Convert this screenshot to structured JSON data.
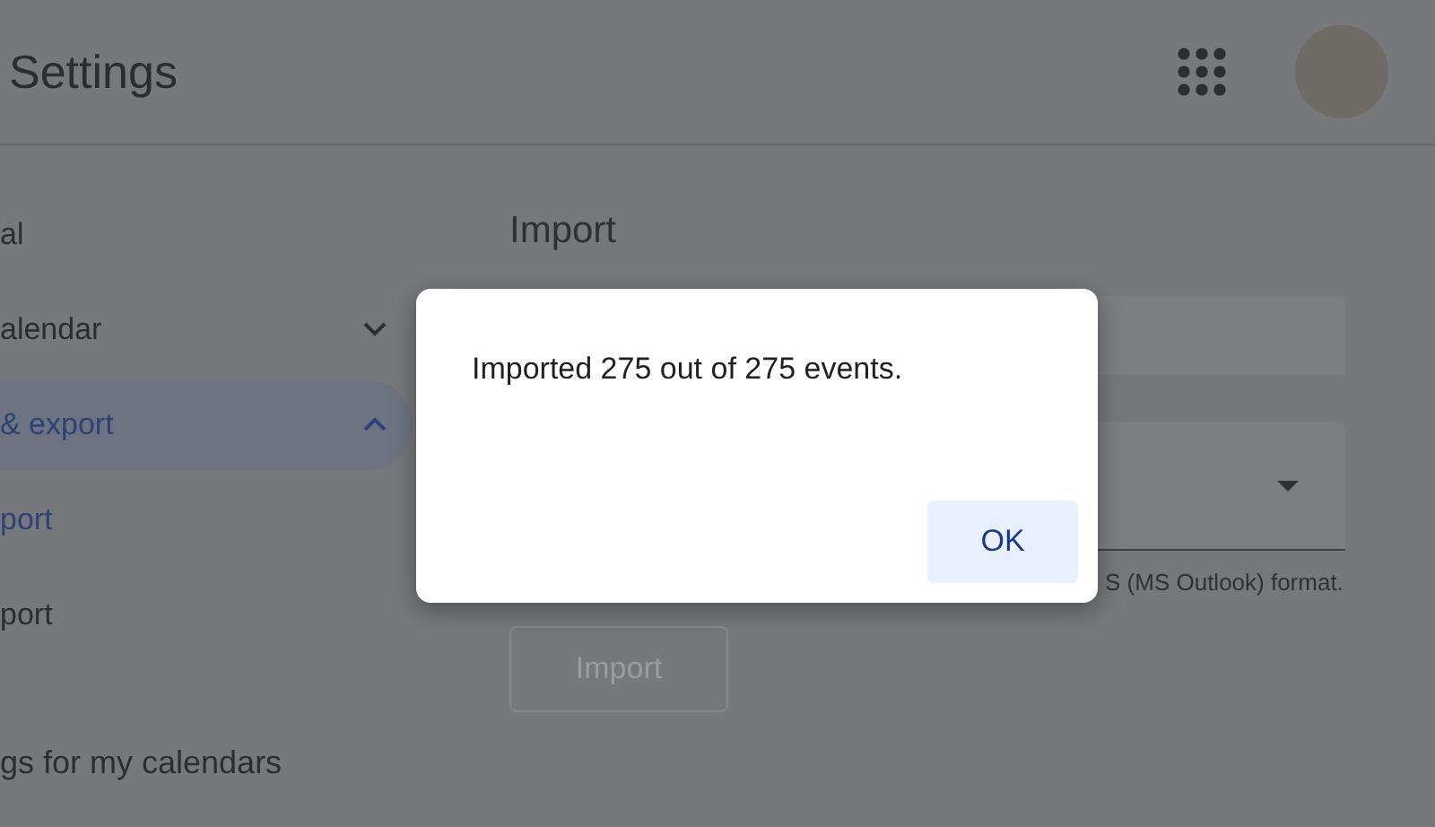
{
  "header": {
    "title": "Settings"
  },
  "sidebar": {
    "items": [
      {
        "label": "al",
        "kind": "item",
        "selected": false
      },
      {
        "label": "alendar",
        "kind": "group",
        "expanded": false,
        "selected": false
      },
      {
        "label": "& export",
        "kind": "group",
        "expanded": true,
        "selected": true
      },
      {
        "label": "port",
        "kind": "subitem",
        "selected": true
      },
      {
        "label": "port",
        "kind": "subitem",
        "selected": false
      }
    ],
    "section_heading": "gs for my calendars"
  },
  "main": {
    "heading": "Import",
    "helper_text": "S (MS Outlook) format.",
    "import_button": {
      "label": "Import",
      "disabled": true
    }
  },
  "dialog": {
    "message": "Imported 275 out of 275 events.",
    "button": "OK"
  }
}
